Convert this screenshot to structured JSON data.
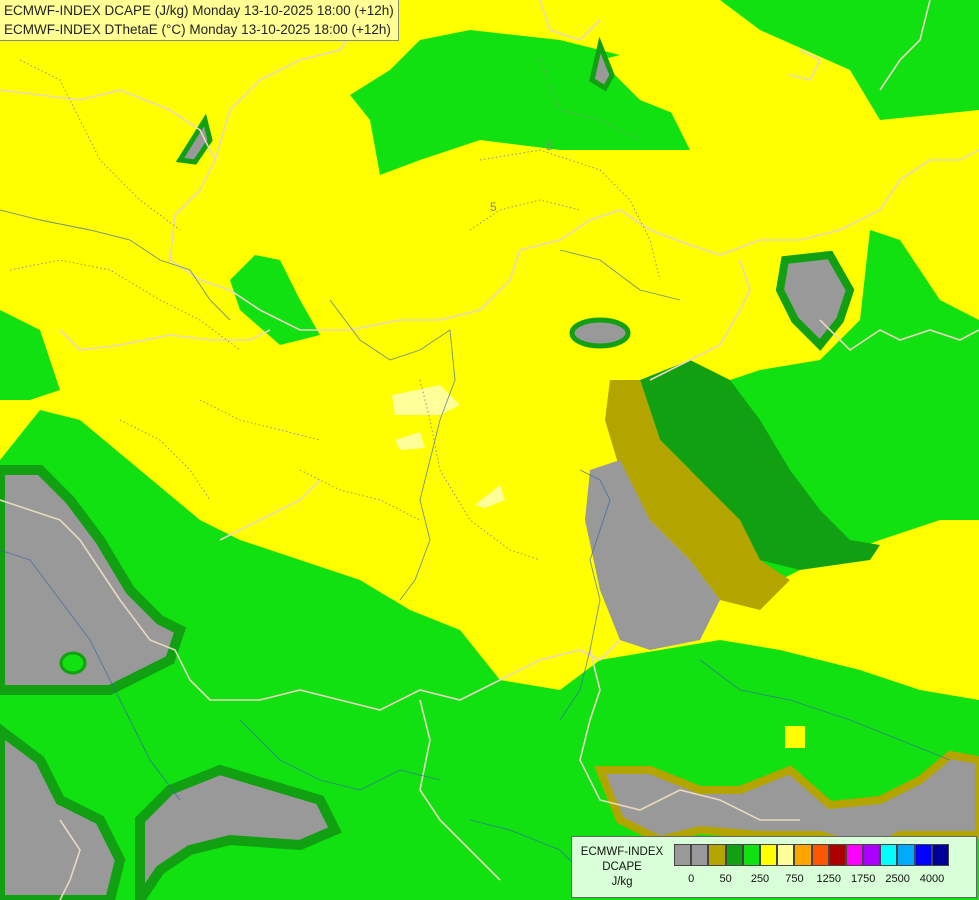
{
  "header": {
    "line1": "ECMWF-INDEX DCAPE (J/kg) Monday 13-10-2025 18:00 (+12h)",
    "line2": "ECMWF-INDEX DThetaE (°C) Monday 13-10-2025 18:00 (+12h)"
  },
  "map": {
    "contour_labels": [
      "5",
      "5"
    ],
    "colors": {
      "grey": "#999999",
      "olive": "#b4a400",
      "dark_green": "#11a011",
      "green": "#11e011",
      "light_green": "#66ff00",
      "yellow": "#ffff00",
      "pale_yellow": "#ffff99",
      "border": "#e8d8c0",
      "river": "#3366aa"
    }
  },
  "legend": {
    "label_lines": [
      "ECMWF-INDEX",
      "DCAPE",
      "J/kg"
    ],
    "swatch_colors": [
      "#999999",
      "#999999",
      "#b4a400",
      "#11a011",
      "#11e011",
      "#ffff00",
      "#ffff99",
      "#ffa500",
      "#ff5500",
      "#aa0000",
      "#ff00ff",
      "#aa00ff",
      "#00ffff",
      "#00aaff",
      "#0000ff",
      "#000099"
    ],
    "tick_labels": [
      "0",
      "50",
      "250",
      "750",
      "1250",
      "1750",
      "2500",
      "4000"
    ]
  }
}
